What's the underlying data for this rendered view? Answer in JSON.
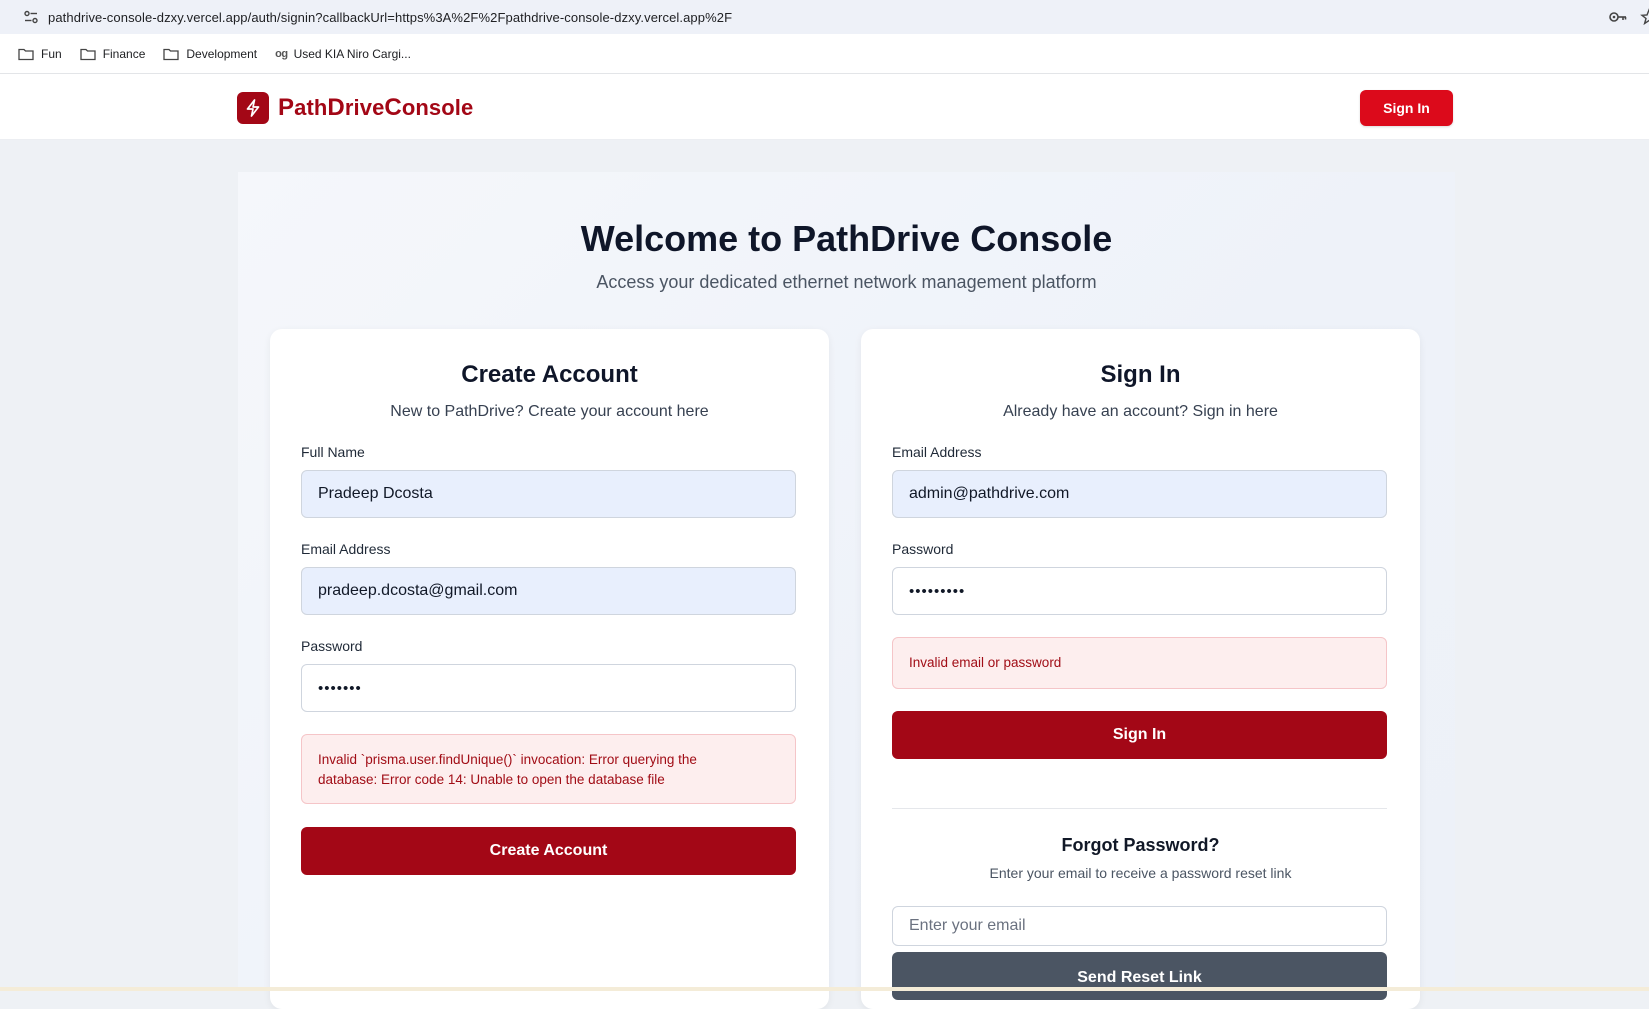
{
  "browser": {
    "url": "pathdrive-console-dzxy.vercel.app/auth/signin?callbackUrl=https%3A%2F%2Fpathdrive-console-dzxy.vercel.app%2F",
    "bookmarks": [
      {
        "label": "Fun",
        "icon": "folder-icon"
      },
      {
        "label": "Finance",
        "icon": "folder-icon"
      },
      {
        "label": "Development",
        "icon": "folder-icon"
      },
      {
        "label": "Used KIA Niro Cargi...",
        "icon": "og-site-icon"
      }
    ]
  },
  "header": {
    "logo_text_parts": [
      "P",
      "ath",
      "D",
      "rive",
      "C",
      "onsole"
    ],
    "sign_in_label": "Sign In",
    "logo_icon": "lightning-bolt-icon"
  },
  "hero": {
    "title": "Welcome to PathDrive Console",
    "subtitle": "Access your dedicated ethernet network management platform"
  },
  "create_account": {
    "title": "Create Account",
    "subtitle": "New to PathDrive? Create your account here",
    "full_name_label": "Full Name",
    "full_name_value": "Pradeep Dcosta",
    "email_label": "Email Address",
    "email_value": "pradeep.dcosta@gmail.com",
    "password_label": "Password",
    "password_value": "1234567",
    "error_line1": "Invalid `prisma.user.findUnique()` invocation: Error querying the",
    "error_line2": "database: Error code 14: Unable to open the database file",
    "submit_label": "Create Account"
  },
  "sign_in": {
    "title": "Sign In",
    "subtitle": "Already have an account? Sign in here",
    "email_label": "Email Address",
    "email_value": "admin@pathdrive.com",
    "password_label": "Password",
    "password_value": "123456789",
    "error": "Invalid email or password",
    "submit_label": "Sign In"
  },
  "forgot_password": {
    "title": "Forgot Password?",
    "description": "Enter your email to receive a password reset link",
    "email_placeholder": "Enter your email",
    "submit_label": "Send Reset Link"
  },
  "colors": {
    "brand": "#a30716",
    "header_button": "#dc0a1b",
    "secondary_button": "#4b5563",
    "error_text": "#a10d16",
    "error_bg": "#fdeeee"
  }
}
